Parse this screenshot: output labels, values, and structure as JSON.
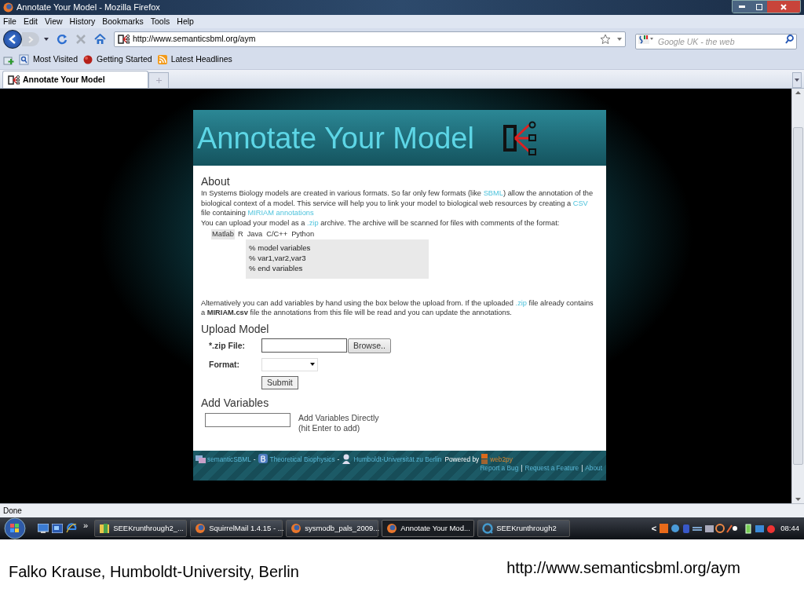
{
  "window": {
    "title": "Annotate Your Model - Mozilla Firefox"
  },
  "menu": [
    "File",
    "Edit",
    "View",
    "History",
    "Bookmarks",
    "Tools",
    "Help"
  ],
  "address_bar": {
    "value": "http://www.semanticsbml.org/aym"
  },
  "search": {
    "placeholder": "Google UK - the web"
  },
  "bookmarks": [
    "Most Visited",
    "Getting Started",
    "Latest Headlines"
  ],
  "tabs": [
    {
      "label": "Annotate Your Model",
      "selected": true
    }
  ],
  "page": {
    "banner_title": "Annotate Your Model",
    "about": {
      "heading": "About",
      "paragraph": [
        {
          "kind": "text",
          "text": "In Systems Biology models are created in various formats. So far only few formats (like "
        },
        {
          "kind": "link",
          "text": "SBML"
        },
        {
          "kind": "text",
          "text": ") allow the annotation of the biological context of a model. This service will help you to link your model to biological web resources by creating a "
        },
        {
          "kind": "link",
          "text": "CSV"
        },
        {
          "kind": "text",
          "text": " file containing "
        },
        {
          "kind": "link",
          "text": "MIRIAM annotations"
        }
      ],
      "upload_line": [
        {
          "kind": "text",
          "text": "You can upload your model as a "
        },
        {
          "kind": "link",
          "text": ".zip"
        },
        {
          "kind": "text",
          "text": " archive. The archive will be scanned for files with comments of the format:"
        }
      ],
      "languages": [
        {
          "label": "Matlab",
          "selected": true
        },
        {
          "label": "R",
          "selected": false
        },
        {
          "label": "Java",
          "selected": false
        },
        {
          "label": "C/C++",
          "selected": false
        },
        {
          "label": "Python",
          "selected": false
        }
      ],
      "code_lines": [
        "% model variables",
        "% var1,var2,var3",
        "% end variables"
      ],
      "alternative": [
        {
          "kind": "text",
          "text": "Alternatively you can add variables by hand using the box below the upload from. If the uploaded "
        },
        {
          "kind": "link",
          "text": ".zip"
        },
        {
          "kind": "text",
          "text": " file already contains a "
        },
        {
          "kind": "bold",
          "text": "MIRIAM.csv"
        },
        {
          "kind": "text",
          "text": " file the annotations from this file will be read and you can update the annotations."
        }
      ]
    },
    "upload": {
      "heading": "Upload Model",
      "file_label": "*.zip File:",
      "browse": "Browse..",
      "format_label": "Format:",
      "submit": "Submit"
    },
    "add_variables": {
      "heading": "Add Variables",
      "hint": [
        "Add Variables Directly",
        "(hit Enter to add)"
      ]
    },
    "footer": {
      "links": [
        "semanticSBML",
        "Theoretical Biophysics",
        "Humboldt-Universität zu Berlin"
      ],
      "separator": "-",
      "powered": "Powered by",
      "powered_link": "web2py",
      "bottom_links": [
        "Report a Bug",
        "Request a Feature",
        "About"
      ],
      "bottom_separator": "|"
    }
  },
  "status_bar": {
    "text": "Done"
  },
  "taskbar": {
    "overflow": "»",
    "items": [
      {
        "label": "SEEKrunthrough2_...",
        "kind": "folder",
        "selected": false
      },
      {
        "label": "SquirrelMail 1.4.15 - ...",
        "kind": "browser",
        "selected": false
      },
      {
        "label": "sysmodb_pals_2009...",
        "kind": "browser",
        "selected": false
      },
      {
        "label": "Annotate Your Mod...",
        "kind": "browser",
        "selected": true
      },
      {
        "label": "SEEKrunthrough2",
        "kind": "player",
        "selected": false
      }
    ],
    "tray_arrow": "<",
    "clock": "08:44"
  },
  "slide_captions": [
    "Falko Krause, Humboldt-University, Berlin",
    "http://www.semanticsbml.org/aym"
  ]
}
